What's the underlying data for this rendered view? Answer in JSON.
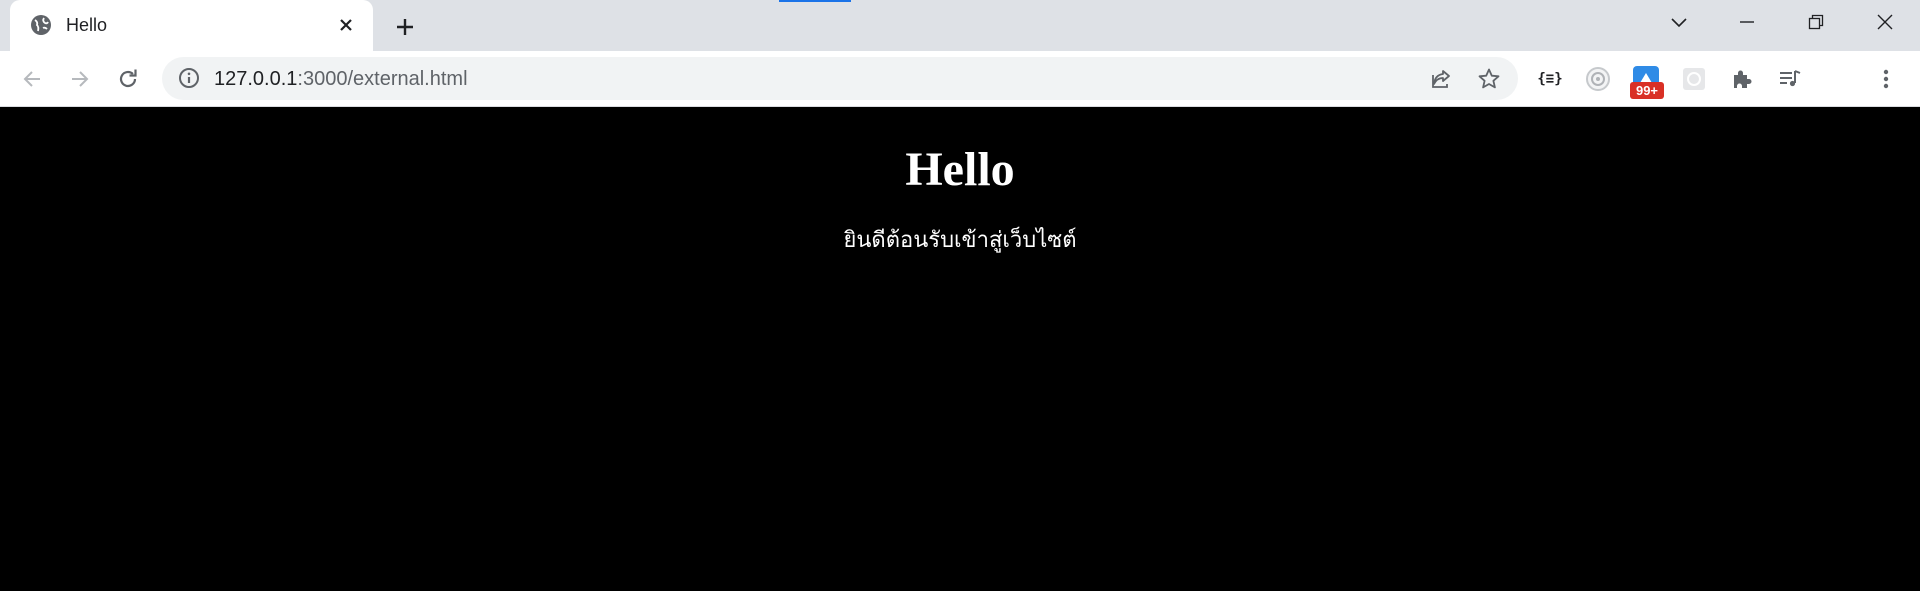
{
  "tab": {
    "title": "Hello"
  },
  "omnibox": {
    "host": "127.0.0.1",
    "path": ":3000/external.html"
  },
  "extensions": {
    "json_viewer_label": "{≡}",
    "badge_count": "99+"
  },
  "page": {
    "heading": "Hello",
    "text": "ยินดีต้อนรับเข้าสู่เว็บไซต์"
  },
  "colors": {
    "tabstrip": "#dee1e6",
    "page_background": "#000000",
    "page_text": "#ffffff",
    "badge": "#d93025",
    "accent": "#1a73e8"
  },
  "icons": [
    "globe-icon",
    "close-icon",
    "plus-icon",
    "chevron-down-icon",
    "minimize-icon",
    "restore-icon",
    "window-close-icon",
    "back-icon",
    "forward-icon",
    "reload-icon",
    "info-icon",
    "share-icon",
    "star-icon",
    "puzzle-icon",
    "media-icon",
    "more-icon"
  ]
}
